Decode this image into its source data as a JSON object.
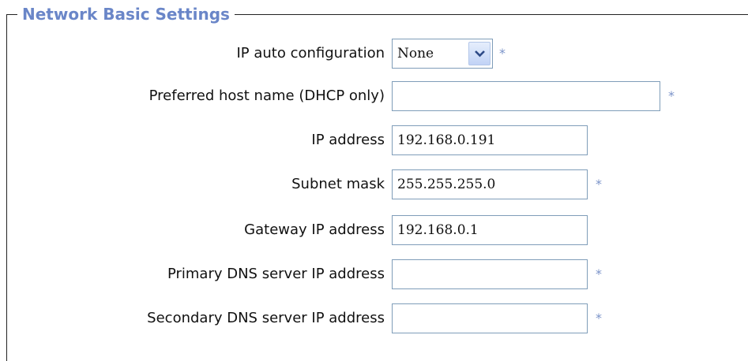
{
  "section": {
    "title": "Network Basic Settings"
  },
  "fields": {
    "ip_auto_config": {
      "label": "IP auto configuration",
      "selected": "None",
      "required_mark": "*"
    },
    "preferred_host_name": {
      "label": "Preferred host name (DHCP only)",
      "value": "",
      "required_mark": "*"
    },
    "ip_address": {
      "label": "IP address",
      "value": "192.168.0.191"
    },
    "subnet_mask": {
      "label": "Subnet mask",
      "value": "255.255.255.0",
      "required_mark": "*"
    },
    "gateway_ip": {
      "label": "Gateway IP address",
      "value": "192.168.0.1"
    },
    "primary_dns": {
      "label": "Primary DNS server IP address",
      "value": "",
      "required_mark": "*"
    },
    "secondary_dns": {
      "label": "Secondary DNS server IP address",
      "value": "",
      "required_mark": "*"
    }
  },
  "icons": {
    "dropdown": "chevron-down-icon"
  },
  "colors": {
    "legend": "#6a86c8",
    "required_mark": "#7b93c9",
    "input_border": "#7f9db9"
  }
}
